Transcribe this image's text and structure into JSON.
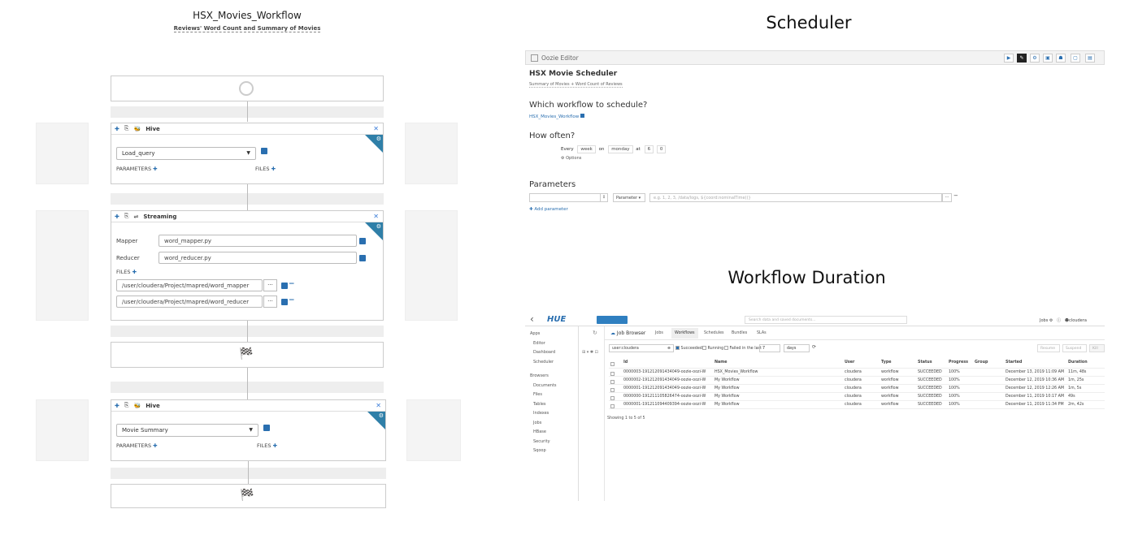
{
  "workflow": {
    "title": "HSX_Movies_Workflow",
    "subtitle": "Reviews' Word Count and Summary of Movies",
    "hive1": {
      "label": "Hive",
      "query": "Load_query",
      "parameters": "PARAMETERS",
      "files": "FILES"
    },
    "streaming": {
      "label": "Streaming",
      "mapper_label": "Mapper",
      "mapper_value": "word_mapper.py",
      "reducer_label": "Reducer",
      "reducer_value": "word_reducer.py",
      "files_label": "FILES",
      "file1": "/user/cloudera/Project/mapred/word_mapper",
      "file2": "/user/cloudera/Project/mapred/word_reducer",
      "dots": "..."
    },
    "hive2": {
      "label": "Hive",
      "query": "Movie Summary",
      "parameters": "PARAMETERS",
      "files": "FILES"
    }
  },
  "scheduler": {
    "heading": "Scheduler",
    "editor_label": "Oozie Editor",
    "name": "HSX Movie Scheduler",
    "desc": "Summary of Movies + Word Count of Reviews",
    "q1": "Which workflow to schedule?",
    "workflow_link": "HSX_Movies_Workflow",
    "q2": "How often?",
    "every": "Every",
    "week": "week",
    "on": "on",
    "day": "monday",
    "at": "at",
    "hour": "6",
    "minute": "0",
    "options": "Options",
    "parameters": "Parameters",
    "param_btn": "Parameter",
    "param_placeholder": "e.g. 1, 2, 3, /data/logs, ${coord:nominalTime()}",
    "add_param": "Add parameter"
  },
  "duration": {
    "heading": "Workflow Duration",
    "user": "Jobs",
    "user_name": "cloudera",
    "search_placeholder": "Search data and saved documents...",
    "sidebar_header": "Apps",
    "sidebar_apps": [
      "Editor",
      "Dashboard",
      "Scheduler"
    ],
    "sidebar_browsers_header": "Browsers",
    "sidebar_browsers": [
      "Documents",
      "Files",
      "Tables",
      "Indexes",
      "Jobs",
      "HBase",
      "Security",
      "Sqoop"
    ],
    "jb_title": "Job Browser",
    "tabs": [
      "Jobs",
      "Workflows",
      "Schedules",
      "Bundles",
      "SLAs"
    ],
    "filter_user": "user:cloudera",
    "filter_succeeded": "Succeeded",
    "filter_running": "Running",
    "filter_failed": "Failed in the last",
    "filter_days_n": "7",
    "filter_days": "days",
    "btn_resume": "Resume",
    "btn_suspend": "Suspend",
    "btn_kill": "Kill",
    "columns": [
      "Id",
      "Name",
      "User",
      "Type",
      "Status",
      "Progress",
      "Group",
      "Started",
      "Duration"
    ],
    "rows": [
      [
        "0000003-191212091434049-oozie-oozi-W",
        "HSX_Movies_Workflow",
        "cloudera",
        "workflow",
        "SUCCEEDED",
        "100%",
        "",
        "December 13, 2019 11:09 AM",
        "11m, 48s"
      ],
      [
        "0000002-191212091434049-oozie-oozi-W",
        "My Workflow",
        "cloudera",
        "workflow",
        "SUCCEEDED",
        "100%",
        "",
        "December 12, 2019 10:36 AM",
        "1m, 25s"
      ],
      [
        "0000001-191212091434049-oozie-oozi-W",
        "My Workflow",
        "cloudera",
        "workflow",
        "SUCCEEDED",
        "100%",
        "",
        "December 12, 2019 12:26 AM",
        "1m, 5s"
      ],
      [
        "0000000-191211105826474-oozie-oozi-W",
        "My Workflow",
        "cloudera",
        "workflow",
        "SUCCEEDED",
        "100%",
        "",
        "December 11, 2019 10:17 AM",
        "49s"
      ],
      [
        "0000001-191211094409394-oozie-oozi-W",
        "My Workflow",
        "cloudera",
        "workflow",
        "SUCCEEDED",
        "100%",
        "",
        "December 11, 2019 11:34 PM",
        "2m, 42s"
      ]
    ],
    "showing": "Showing 1 to 5 of 5"
  }
}
